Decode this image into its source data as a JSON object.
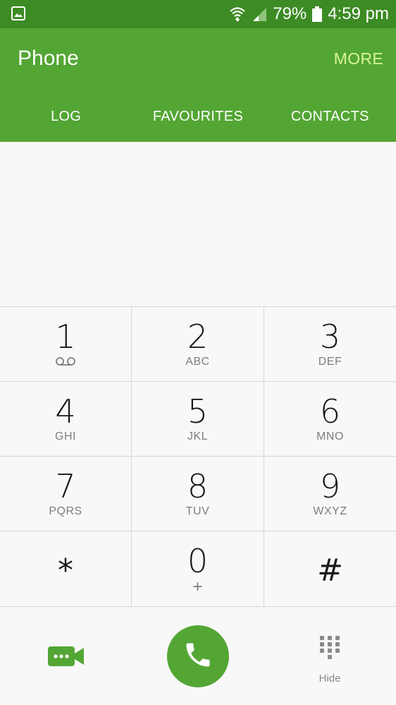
{
  "status_bar": {
    "battery": "79%",
    "time": "4:59 pm",
    "icons": [
      "gallery-notification-icon",
      "wifi-icon",
      "signal-icon",
      "battery-icon"
    ]
  },
  "app_bar": {
    "title": "Phone",
    "more_label": "MORE",
    "tabs": [
      {
        "label": "LOG"
      },
      {
        "label": "FAVOURITES"
      },
      {
        "label": "CONTACTS"
      }
    ]
  },
  "keypad": {
    "keys": [
      {
        "digit": "1",
        "letters": "",
        "icon": "voicemail-icon"
      },
      {
        "digit": "2",
        "letters": "ABC"
      },
      {
        "digit": "3",
        "letters": "DEF"
      },
      {
        "digit": "4",
        "letters": "GHI"
      },
      {
        "digit": "5",
        "letters": "JKL"
      },
      {
        "digit": "6",
        "letters": "MNO"
      },
      {
        "digit": "7",
        "letters": "PQRS"
      },
      {
        "digit": "8",
        "letters": "TUV"
      },
      {
        "digit": "9",
        "letters": "WXYZ"
      },
      {
        "digit": "*",
        "letters": ""
      },
      {
        "digit": "0",
        "letters": "+"
      },
      {
        "digit": "#",
        "letters": ""
      }
    ]
  },
  "bottom_bar": {
    "hide_label": "Hide",
    "icons": [
      "video-call-icon",
      "phone-icon",
      "keypad-icon"
    ]
  },
  "colors": {
    "status_bar": "#3d8b25",
    "app_bar": "#53a634",
    "more_text": "#d8f59a",
    "background": "#f8f8f8"
  }
}
